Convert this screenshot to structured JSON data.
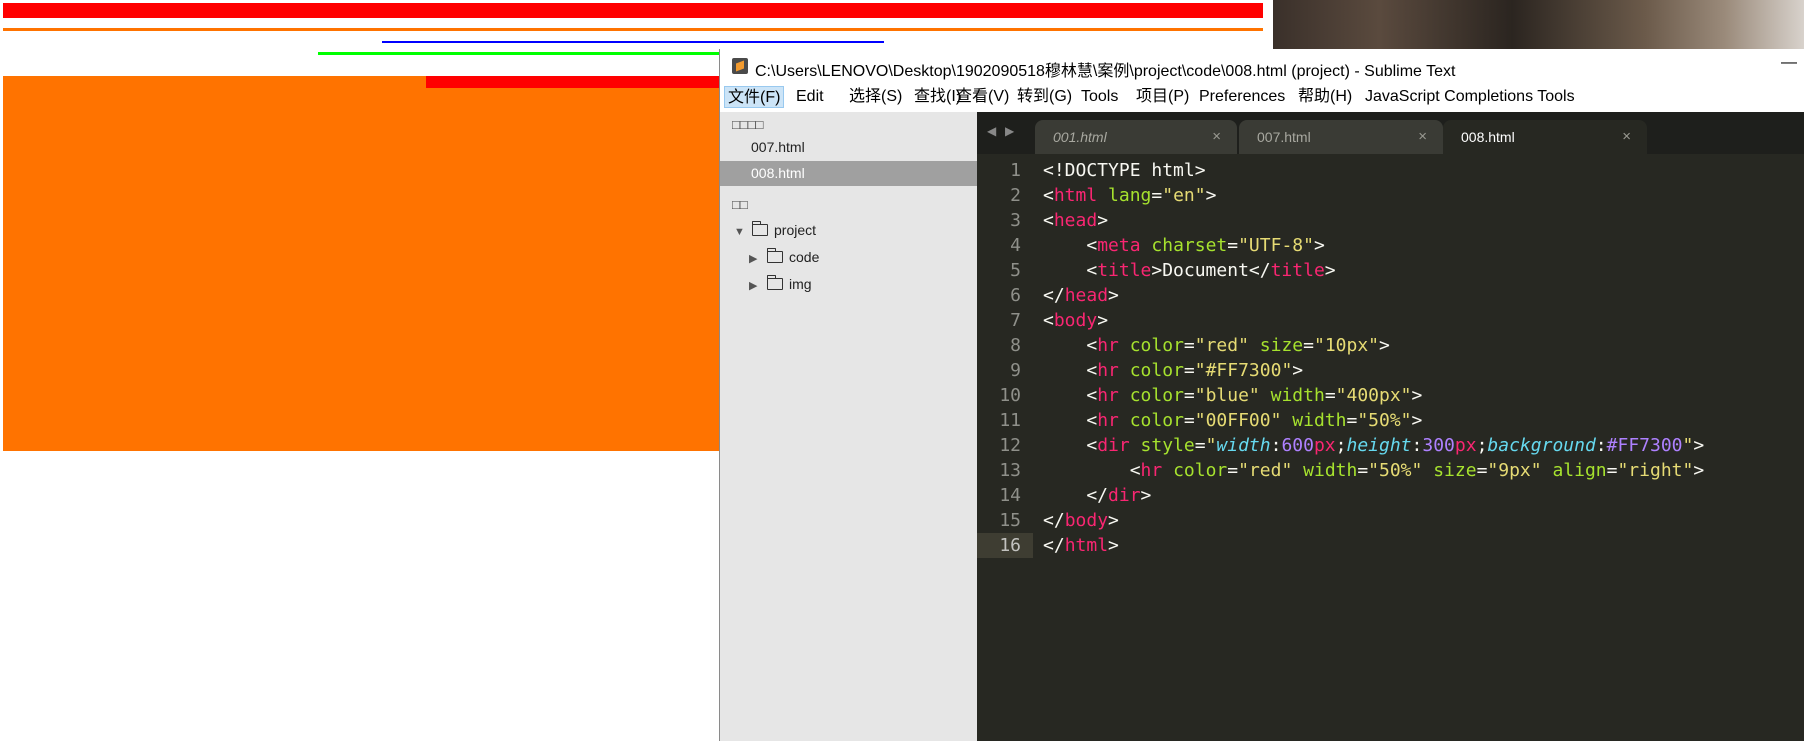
{
  "browser": {
    "colors": {
      "red": "#FF0000",
      "orange": "#FF7300",
      "blue": "#0000FF",
      "green": "#00FF00"
    }
  },
  "window": {
    "title": "C:\\Users\\LENOVO\\Desktop\\1902090518穆林慧\\案例\\project\\code\\008.html (project) - Sublime Text",
    "minimize": "—"
  },
  "menu": [
    "文件(F)",
    "Edit",
    "选择(S)",
    "查找(I)",
    "查看(V)",
    "转到(G)",
    "Tools",
    "项目(P)",
    "Preferences",
    "帮助(H)",
    "JavaScript Completions Tools"
  ],
  "sidebar": {
    "open_files_header": "□□□□",
    "open_files": [
      "007.html",
      "008.html"
    ],
    "folders_header": "□□",
    "tree": [
      {
        "label": "project",
        "expanded": true,
        "arrow": "▼"
      },
      {
        "label": "code",
        "expanded": false,
        "arrow": "▶"
      },
      {
        "label": "img",
        "expanded": false,
        "arrow": "▶"
      }
    ]
  },
  "tabs": [
    {
      "label": "001.html",
      "italic": true,
      "close": "×"
    },
    {
      "label": "007.html",
      "italic": false,
      "close": "×"
    },
    {
      "label": "008.html",
      "italic": false,
      "close": "×",
      "active": true
    }
  ],
  "nav": {
    "back": "◀",
    "forward": "▶"
  },
  "code": {
    "line_numbers": [
      "1",
      "2",
      "3",
      "4",
      "5",
      "6",
      "7",
      "8",
      "9",
      "10",
      "11",
      "12",
      "13",
      "14",
      "15",
      "16"
    ],
    "current_line": 16,
    "lines": [
      [
        [
          "pl",
          "<!DOCTYPE html>"
        ]
      ],
      [
        [
          "pl",
          "<"
        ],
        [
          "tg",
          "html"
        ],
        [
          "pl",
          " "
        ],
        [
          "at",
          "lang"
        ],
        [
          "pl",
          "="
        ],
        [
          "st",
          "\"en\""
        ],
        [
          "pl",
          ">"
        ]
      ],
      [
        [
          "pl",
          "<"
        ],
        [
          "tg",
          "head"
        ],
        [
          "pl",
          ">"
        ]
      ],
      [
        [
          "pl",
          "    <"
        ],
        [
          "tg",
          "meta"
        ],
        [
          "pl",
          " "
        ],
        [
          "at",
          "charset"
        ],
        [
          "pl",
          "="
        ],
        [
          "st",
          "\"UTF-8\""
        ],
        [
          "pl",
          ">"
        ]
      ],
      [
        [
          "pl",
          "    <"
        ],
        [
          "tg",
          "title"
        ],
        [
          "pl",
          ">Document</"
        ],
        [
          "tg",
          "title"
        ],
        [
          "pl",
          ">"
        ]
      ],
      [
        [
          "pl",
          "</"
        ],
        [
          "tg",
          "head"
        ],
        [
          "pl",
          ">"
        ]
      ],
      [
        [
          "pl",
          "<"
        ],
        [
          "tg",
          "body"
        ],
        [
          "pl",
          ">"
        ]
      ],
      [
        [
          "pl",
          "    <"
        ],
        [
          "tg",
          "hr"
        ],
        [
          "pl",
          " "
        ],
        [
          "at",
          "color"
        ],
        [
          "pl",
          "="
        ],
        [
          "st",
          "\"red\""
        ],
        [
          "pl",
          " "
        ],
        [
          "at",
          "size"
        ],
        [
          "pl",
          "="
        ],
        [
          "st",
          "\"10px\""
        ],
        [
          "pl",
          ">"
        ]
      ],
      [
        [
          "pl",
          "    <"
        ],
        [
          "tg",
          "hr"
        ],
        [
          "pl",
          " "
        ],
        [
          "at",
          "color"
        ],
        [
          "pl",
          "="
        ],
        [
          "st",
          "\"#FF7300\""
        ],
        [
          "pl",
          ">"
        ]
      ],
      [
        [
          "pl",
          "    <"
        ],
        [
          "tg",
          "hr"
        ],
        [
          "pl",
          " "
        ],
        [
          "at",
          "color"
        ],
        [
          "pl",
          "="
        ],
        [
          "st",
          "\"blue\""
        ],
        [
          "pl",
          " "
        ],
        [
          "at",
          "width"
        ],
        [
          "pl",
          "="
        ],
        [
          "st",
          "\"400px\""
        ],
        [
          "pl",
          ">"
        ]
      ],
      [
        [
          "pl",
          "    <"
        ],
        [
          "tg",
          "hr"
        ],
        [
          "pl",
          " "
        ],
        [
          "at",
          "color"
        ],
        [
          "pl",
          "="
        ],
        [
          "st",
          "\"00FF00\""
        ],
        [
          "pl",
          " "
        ],
        [
          "at",
          "width"
        ],
        [
          "pl",
          "="
        ],
        [
          "st",
          "\"50%\""
        ],
        [
          "pl",
          ">"
        ]
      ],
      [
        [
          "pl",
          "    <"
        ],
        [
          "tg",
          "dir"
        ],
        [
          "pl",
          " "
        ],
        [
          "at",
          "style"
        ],
        [
          "pl",
          "="
        ],
        [
          "st",
          "\""
        ],
        [
          "pr",
          "width"
        ],
        [
          "pl",
          ":"
        ],
        [
          "nu",
          "600"
        ],
        [
          "un",
          "px"
        ],
        [
          "pl",
          ";"
        ],
        [
          "pr",
          "height"
        ],
        [
          "pl",
          ":"
        ],
        [
          "nu",
          "300"
        ],
        [
          "un",
          "px"
        ],
        [
          "pl",
          ";"
        ],
        [
          "pr",
          "background"
        ],
        [
          "pl",
          ":"
        ],
        [
          "co",
          "#FF7300"
        ],
        [
          "st",
          "\""
        ],
        [
          "pl",
          ">"
        ]
      ],
      [
        [
          "pl",
          "        <"
        ],
        [
          "tg",
          "hr"
        ],
        [
          "pl",
          " "
        ],
        [
          "at",
          "color"
        ],
        [
          "pl",
          "="
        ],
        [
          "st",
          "\"red\""
        ],
        [
          "pl",
          " "
        ],
        [
          "at",
          "width"
        ],
        [
          "pl",
          "="
        ],
        [
          "st",
          "\"50%\""
        ],
        [
          "pl",
          " "
        ],
        [
          "at",
          "size"
        ],
        [
          "pl",
          "="
        ],
        [
          "st",
          "\"9px\""
        ],
        [
          "pl",
          " "
        ],
        [
          "at",
          "align"
        ],
        [
          "pl",
          "="
        ],
        [
          "st",
          "\"right\""
        ],
        [
          "pl",
          ">"
        ]
      ],
      [
        [
          "pl",
          "    </"
        ],
        [
          "tg",
          "dir"
        ],
        [
          "pl",
          ">"
        ]
      ],
      [
        [
          "pl",
          "</"
        ],
        [
          "tg",
          "body"
        ],
        [
          "pl",
          ">"
        ]
      ],
      [
        [
          "pl",
          "</"
        ],
        [
          "tg",
          "html"
        ],
        [
          "pl",
          ">"
        ]
      ]
    ]
  }
}
